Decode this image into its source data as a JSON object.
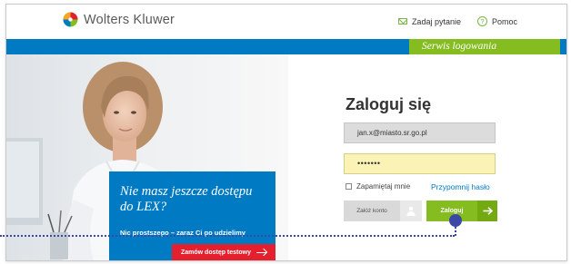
{
  "header": {
    "brand": "Wolters Kluwer",
    "ask_link": "Zadaj pytanie",
    "help_link": "Pomoc"
  },
  "service_label": "Serwis logowania",
  "promo": {
    "title": "Nie masz jeszcze dostępu do LEX?",
    "subtitle": "Nic prostszego – zaraz Ci go udzielimy",
    "cta": "Zamów dostęp testowy"
  },
  "login": {
    "title": "Zaloguj się",
    "email_value": "jan.x@miasto.sr.go.pl",
    "password_value": "•••••••",
    "remember_label": "Zapamiętaj mnie",
    "forgot_link": "Przypomnij hasło",
    "create_account": "Załóż konto",
    "submit": "Zaloguj"
  },
  "colors": {
    "brand_blue": "#007ac3",
    "brand_green": "#85bc20",
    "cta_red": "#e5202e",
    "marker": "#3b48a6"
  }
}
